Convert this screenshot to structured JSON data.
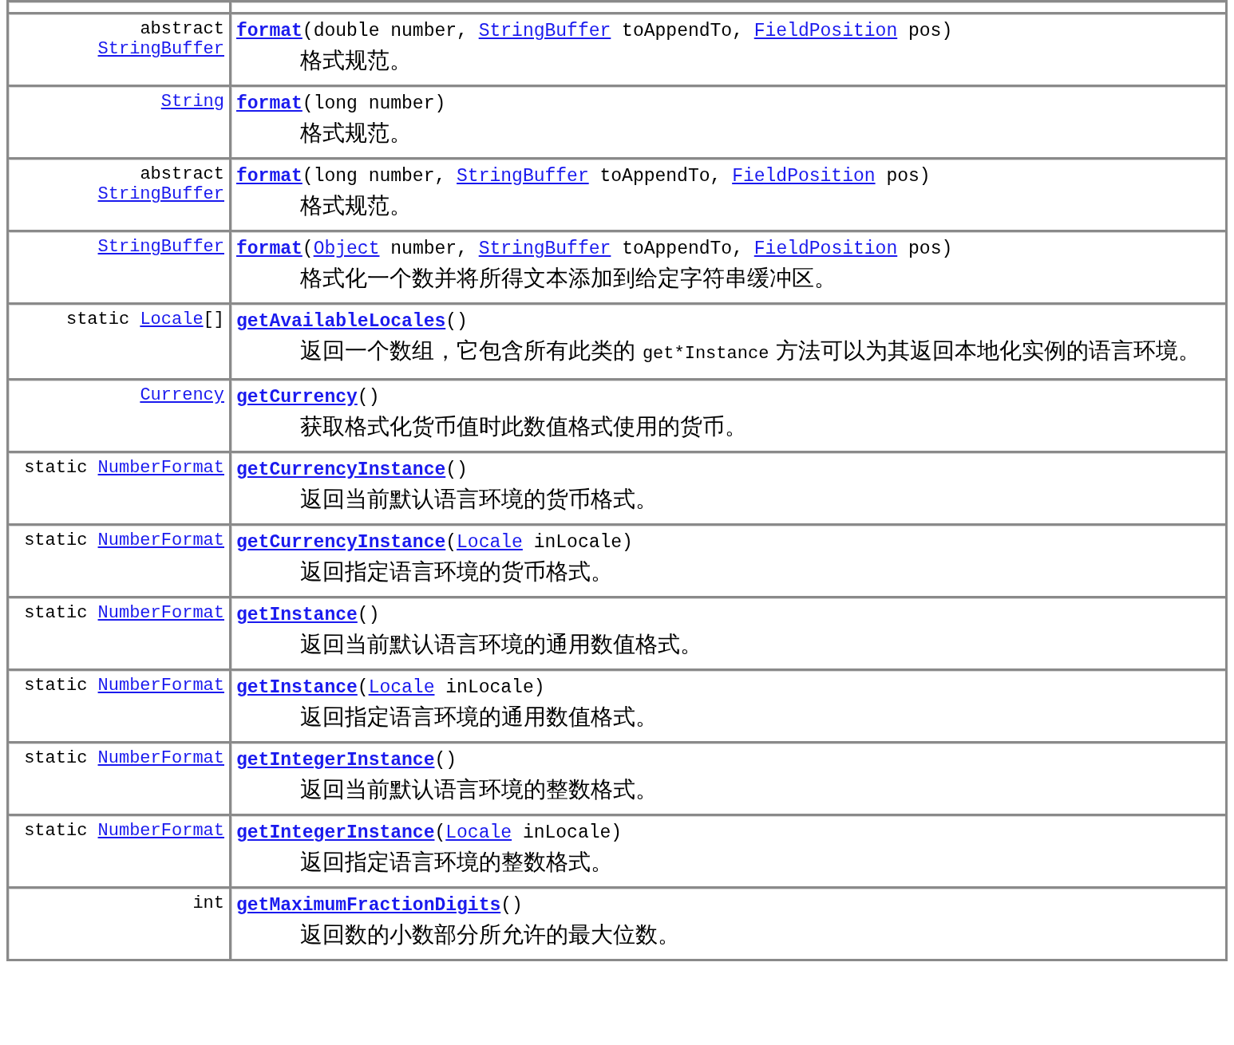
{
  "rows": [
    {
      "type": [
        {
          "kind": "text",
          "text": "abstract"
        },
        {
          "kind": "link",
          "text": "StringBuffer"
        }
      ],
      "signature": [
        {
          "kind": "method",
          "text": "format"
        },
        {
          "kind": "text",
          "text": "(double number, "
        },
        {
          "kind": "link",
          "text": "StringBuffer"
        },
        {
          "kind": "text",
          "text": " toAppendTo, "
        },
        {
          "kind": "link",
          "text": "FieldPosition"
        },
        {
          "kind": "text",
          "text": " pos)"
        }
      ],
      "description": [
        {
          "kind": "text",
          "text": "格式规范。"
        }
      ]
    },
    {
      "type": [
        {
          "kind": "link",
          "text": "String"
        }
      ],
      "signature": [
        {
          "kind": "method",
          "text": "format"
        },
        {
          "kind": "text",
          "text": "(long number)"
        }
      ],
      "description": [
        {
          "kind": "text",
          "text": "格式规范。"
        }
      ]
    },
    {
      "type": [
        {
          "kind": "text",
          "text": "abstract"
        },
        {
          "kind": "link",
          "text": "StringBuffer"
        }
      ],
      "signature": [
        {
          "kind": "method",
          "text": "format"
        },
        {
          "kind": "text",
          "text": "(long number, "
        },
        {
          "kind": "link",
          "text": "StringBuffer"
        },
        {
          "kind": "text",
          "text": " toAppendTo, "
        },
        {
          "kind": "link",
          "text": "FieldPosition"
        },
        {
          "kind": "text",
          "text": " pos)"
        }
      ],
      "description": [
        {
          "kind": "text",
          "text": "格式规范。"
        }
      ]
    },
    {
      "type": [
        {
          "kind": "link",
          "text": "StringBuffer"
        }
      ],
      "signature": [
        {
          "kind": "method",
          "text": "format"
        },
        {
          "kind": "text",
          "text": "("
        },
        {
          "kind": "link",
          "text": "Object"
        },
        {
          "kind": "text",
          "text": " number, "
        },
        {
          "kind": "link",
          "text": "StringBuffer"
        },
        {
          "kind": "text",
          "text": " toAppendTo, "
        },
        {
          "kind": "link",
          "text": "FieldPosition"
        },
        {
          "kind": "text",
          "text": " pos)"
        }
      ],
      "description": [
        {
          "kind": "text",
          "text": "格式化一个数并将所得文本添加到给定字符串缓冲区。"
        }
      ]
    },
    {
      "type": [
        {
          "kind": "text",
          "text": "static"
        },
        {
          "kind": "link",
          "text": "Locale"
        },
        {
          "kind": "text",
          "text": "[]"
        }
      ],
      "signature": [
        {
          "kind": "method",
          "text": "getAvailableLocales"
        },
        {
          "kind": "text",
          "text": "()"
        }
      ],
      "description": [
        {
          "kind": "text",
          "text": "返回一个数组，它包含所有此类的 "
        },
        {
          "kind": "code",
          "text": "get*Instance"
        },
        {
          "kind": "text",
          "text": " 方法可以为其返回本地化实例的语言环境。"
        }
      ]
    },
    {
      "type": [
        {
          "kind": "link",
          "text": "Currency"
        }
      ],
      "signature": [
        {
          "kind": "method",
          "text": "getCurrency"
        },
        {
          "kind": "text",
          "text": "()"
        }
      ],
      "description": [
        {
          "kind": "text",
          "text": "获取格式化货币值时此数值格式使用的货币。"
        }
      ]
    },
    {
      "type": [
        {
          "kind": "text",
          "text": "static"
        },
        {
          "kind": "link",
          "text": "NumberFormat"
        }
      ],
      "signature": [
        {
          "kind": "method",
          "text": "getCurrencyInstance"
        },
        {
          "kind": "text",
          "text": "()"
        }
      ],
      "description": [
        {
          "kind": "text",
          "text": "返回当前默认语言环境的货币格式。"
        }
      ]
    },
    {
      "type": [
        {
          "kind": "text",
          "text": "static"
        },
        {
          "kind": "link",
          "text": "NumberFormat"
        }
      ],
      "signature": [
        {
          "kind": "method",
          "text": "getCurrencyInstance"
        },
        {
          "kind": "text",
          "text": "("
        },
        {
          "kind": "link",
          "text": "Locale"
        },
        {
          "kind": "text",
          "text": " inLocale)"
        }
      ],
      "description": [
        {
          "kind": "text",
          "text": "返回指定语言环境的货币格式。"
        }
      ]
    },
    {
      "type": [
        {
          "kind": "text",
          "text": "static"
        },
        {
          "kind": "link",
          "text": "NumberFormat"
        }
      ],
      "signature": [
        {
          "kind": "method",
          "text": "getInstance"
        },
        {
          "kind": "text",
          "text": "()"
        }
      ],
      "description": [
        {
          "kind": "text",
          "text": "返回当前默认语言环境的通用数值格式。"
        }
      ]
    },
    {
      "type": [
        {
          "kind": "text",
          "text": "static"
        },
        {
          "kind": "link",
          "text": "NumberFormat"
        }
      ],
      "signature": [
        {
          "kind": "method",
          "text": "getInstance"
        },
        {
          "kind": "text",
          "text": "("
        },
        {
          "kind": "link",
          "text": "Locale"
        },
        {
          "kind": "text",
          "text": " inLocale)"
        }
      ],
      "description": [
        {
          "kind": "text",
          "text": "返回指定语言环境的通用数值格式。"
        }
      ]
    },
    {
      "type": [
        {
          "kind": "text",
          "text": "static"
        },
        {
          "kind": "link",
          "text": "NumberFormat"
        }
      ],
      "signature": [
        {
          "kind": "method",
          "text": "getIntegerInstance"
        },
        {
          "kind": "text",
          "text": "()"
        }
      ],
      "description": [
        {
          "kind": "text",
          "text": "返回当前默认语言环境的整数格式。"
        }
      ]
    },
    {
      "type": [
        {
          "kind": "text",
          "text": "static"
        },
        {
          "kind": "link",
          "text": "NumberFormat"
        }
      ],
      "signature": [
        {
          "kind": "method",
          "text": "getIntegerInstance"
        },
        {
          "kind": "text",
          "text": "("
        },
        {
          "kind": "link",
          "text": "Locale"
        },
        {
          "kind": "text",
          "text": " inLocale)"
        }
      ],
      "description": [
        {
          "kind": "text",
          "text": "返回指定语言环境的整数格式。"
        }
      ]
    },
    {
      "type": [
        {
          "kind": "text",
          "text": "int"
        }
      ],
      "signature": [
        {
          "kind": "method",
          "text": "getMaximumFractionDigits"
        },
        {
          "kind": "text",
          "text": "()"
        }
      ],
      "description": [
        {
          "kind": "text",
          "text": "返回数的小数部分所允许的最大位数。"
        }
      ]
    }
  ]
}
